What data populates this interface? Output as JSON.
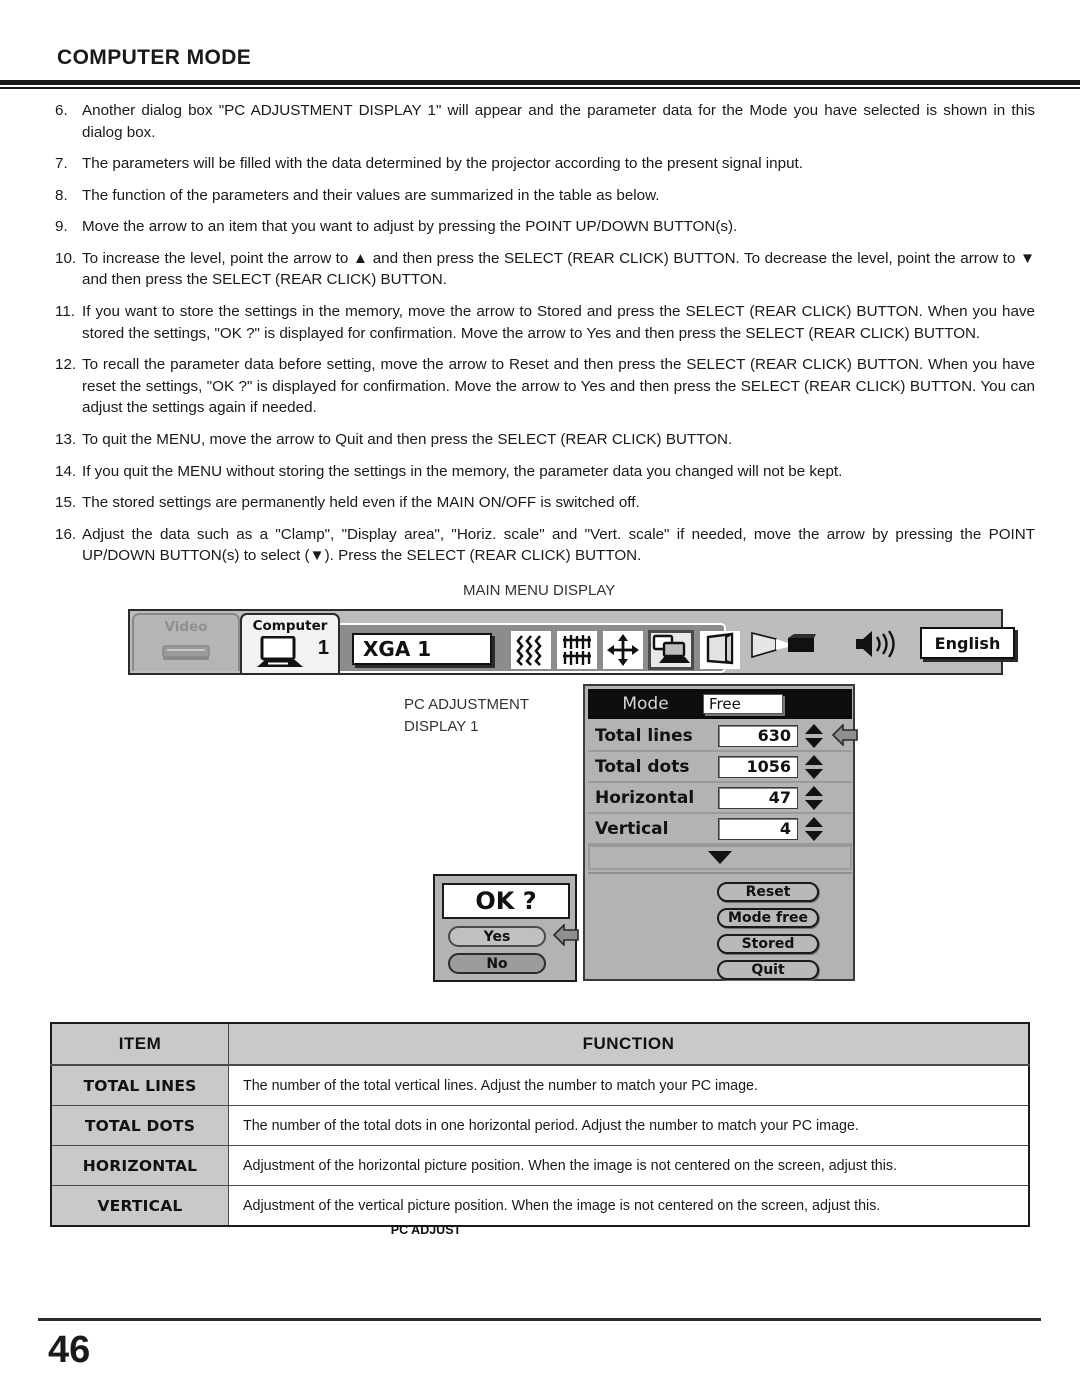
{
  "header": {
    "title": "COMPUTER MODE"
  },
  "steps": [
    {
      "num": "6.",
      "text": "Another dialog box \"PC ADJUSTMENT DISPLAY 1\" will appear and the parameter data for the Mode you have selected is shown in this dialog box."
    },
    {
      "num": "7.",
      "text": "The parameters will be filled with the data determined by the projector according to the present signal input."
    },
    {
      "num": "8.",
      "text": "The function of the parameters and their values are summarized in the table as below."
    },
    {
      "num": "9.",
      "text": "Move the arrow to an item that you want to adjust by pressing the POINT UP/DOWN BUTTON(s)."
    },
    {
      "num": "10.",
      "text": "To increase the level, point the arrow to ▲ and then press the SELECT (REAR CLICK) BUTTON. To decrease the level, point the arrow to ▼ and then press the SELECT (REAR CLICK) BUTTON."
    },
    {
      "num": "11.",
      "text": "If you want to store the settings in the memory, move the arrow to Stored and press the SELECT (REAR CLICK) BUTTON. When you have stored the settings, \"OK ?\" is displayed for confirmation.  Move the arrow to Yes and then press the SELECT (REAR CLICK) BUTTON."
    },
    {
      "num": "12.",
      "text": "To recall the parameter data before setting, move the arrow to Reset and then press the SELECT (REAR CLICK) BUTTON. When you have reset the settings, \"OK ?\" is displayed for confirmation. Move the arrow to Yes and then press the SELECT (REAR CLICK) BUTTON. You can adjust the settings again if needed."
    },
    {
      "num": "13.",
      "text": "To quit the MENU, move the arrow to Quit and then press the SELECT (REAR CLICK) BUTTON."
    },
    {
      "num": "14.",
      "text": "If you quit the MENU without storing the settings in the memory, the parameter data you changed will not be kept."
    },
    {
      "num": "15.",
      "text": "The stored settings are permanently held even if the MAIN ON/OFF is switched off."
    },
    {
      "num": "16.",
      "text": "Adjust the data such as a \"Clamp\", \"Display area\", \"Horiz. scale\" and \"Vert. scale\" if needed, move the arrow by pressing the POINT UP/DOWN BUTTON(s) to select (▼). Press the SELECT (REAR CLICK) BUTTON."
    }
  ],
  "figure": {
    "main_menu_caption": "MAIN MENU DISPLAY",
    "pc_adjustment_caption_line1": "PC ADJUSTMENT",
    "pc_adjustment_caption_line2": "DISPLAY 1",
    "menubar": {
      "tab_video_label": "Video",
      "tab_computer_label": "Computer",
      "tab_computer_number": "1",
      "group_title": "PC ADJUST",
      "mode_value": "XGA 1",
      "language_value": "English",
      "icons": [
        "fine-sync-icon",
        "total-dots-icon",
        "picture-position-icon",
        "pc-adjust-icon",
        "screen-icon",
        "projector-icon",
        "volume-icon"
      ]
    },
    "pc_panel": {
      "mode_label": "Mode",
      "mode_value": "Free",
      "rows": [
        {
          "label": "Total lines",
          "value": "630"
        },
        {
          "label": "Total dots",
          "value": "1056"
        },
        {
          "label": "Horizontal",
          "value": "47"
        },
        {
          "label": "Vertical",
          "value": "4"
        }
      ],
      "buttons": [
        "Reset",
        "Mode free",
        "Stored",
        "Quit"
      ]
    },
    "ok_dialog": {
      "message": "OK ?",
      "yes_label": "Yes",
      "no_label": "No"
    }
  },
  "table": {
    "headers": {
      "item": "ITEM",
      "function": "FUNCTION"
    },
    "rows": [
      {
        "item": "TOTAL LINES",
        "function": "The number of the total vertical lines. Adjust the number to match your PC image."
      },
      {
        "item": "TOTAL DOTS",
        "function": "The number of the total dots in one horizontal period. Adjust the number to match your PC image."
      },
      {
        "item": "HORIZONTAL",
        "function": "Adjustment of the horizontal picture position. When the image is not centered on the screen, adjust this."
      },
      {
        "item": "VERTICAL",
        "function": "Adjustment of the vertical picture position. When the image is not centered on the screen, adjust this."
      }
    ]
  },
  "footer": {
    "page_number": "46"
  }
}
